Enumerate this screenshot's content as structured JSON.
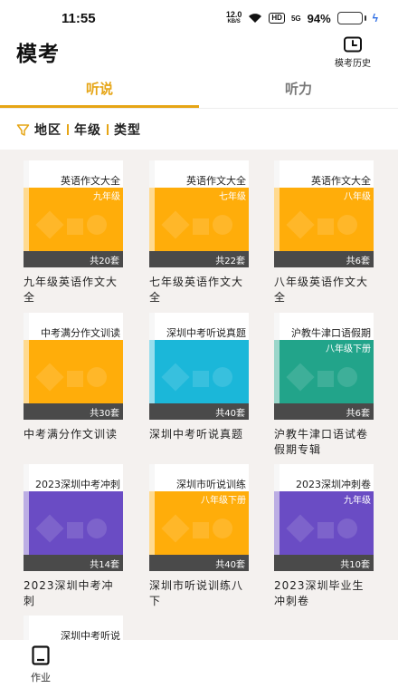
{
  "status": {
    "time": "11:55",
    "speed": "12.0",
    "speed_unit": "KB/S",
    "hd": "HD",
    "signal": "5G",
    "battery": "94%"
  },
  "header": {
    "title": "模考",
    "history_label": "模考历史"
  },
  "tabs": [
    {
      "label": "听说",
      "active": true
    },
    {
      "label": "听力",
      "active": false
    }
  ],
  "filters": [
    "地区",
    "年级",
    "类型"
  ],
  "books": [
    {
      "cover_title": "英语作文大全",
      "grade": "九年级",
      "count": "共20套",
      "name": "九年级英语作文大全",
      "color": "#ffad0a"
    },
    {
      "cover_title": "英语作文大全",
      "grade": "七年级",
      "count": "共22套",
      "name": "七年级英语作文大全",
      "color": "#ffad0a"
    },
    {
      "cover_title": "英语作文大全",
      "grade": "八年级",
      "count": "共6套",
      "name": "八年级英语作文大全",
      "color": "#ffad0a"
    },
    {
      "cover_title": "中考满分作文训读",
      "grade": "",
      "count": "共30套",
      "name": "中考满分作文训读",
      "color": "#ffad0a"
    },
    {
      "cover_title": "深圳中考听说真题",
      "grade": "",
      "count": "共40套",
      "name": "深圳中考听说真题",
      "color": "#1bb7d9"
    },
    {
      "cover_title": "沪教牛津口语假期",
      "grade": "八年级下册",
      "count": "共6套",
      "name": "沪教牛津口语试卷假期专辑",
      "color": "#22a48a"
    },
    {
      "cover_title": "2023深圳中考冲刺",
      "grade": "",
      "count": "共14套",
      "name": "2023深圳中考冲刺",
      "color": "#6a4cc4"
    },
    {
      "cover_title": "深圳市听说训练",
      "grade": "八年级下册",
      "count": "共40套",
      "name": "深圳市听说训练八下",
      "color": "#ffad0a"
    },
    {
      "cover_title": "2023深圳冲刺卷",
      "grade": "九年级",
      "count": "共10套",
      "name": "2023深圳毕业生冲刺卷",
      "color": "#6a4cc4"
    },
    {
      "cover_title": "深圳中考听说",
      "grade": "",
      "count": "",
      "name": "",
      "color": "#ffad0a"
    }
  ],
  "bottom_nav": {
    "homework_label": "作业"
  }
}
